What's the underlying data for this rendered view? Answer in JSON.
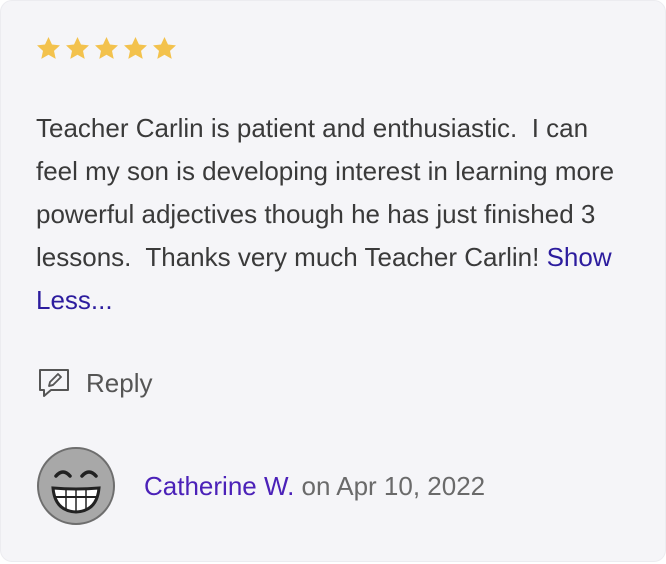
{
  "review": {
    "rating": 5,
    "rating_max": 5,
    "star_color": "#f3c24d",
    "text": "Teacher Carlin is patient and enthusiastic.  I can feel my son is developing interest in learning more powerful adjectives though he has just finished 3 lessons.  Thanks very much Teacher Carlin! ",
    "show_less_label": "Show Less..."
  },
  "actions": {
    "reply_label": "Reply",
    "reply_icon": "reply-edit-icon"
  },
  "author": {
    "name": "Catherine W.",
    "date_prefix": " on ",
    "date": "Apr 10, 2022",
    "avatar_icon": "smiley-avatar"
  },
  "colors": {
    "link": "#2c1c9e",
    "author_link": "#4b21b8",
    "text": "#3a3a3a",
    "card_bg": "#f5f5f8"
  }
}
